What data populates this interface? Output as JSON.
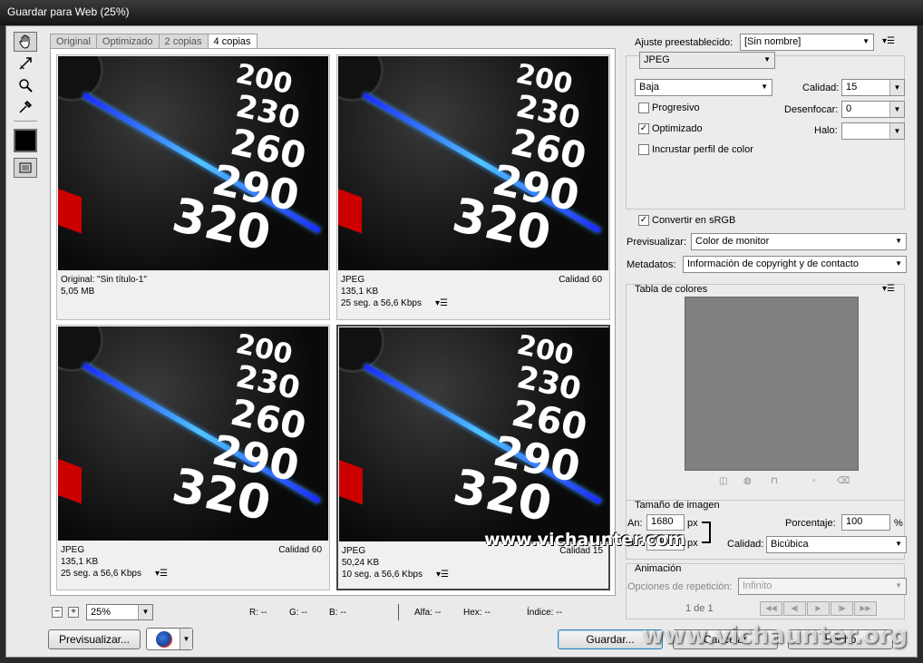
{
  "window": {
    "title": "Guardar para Web (25%)"
  },
  "tools": [
    "hand-tool",
    "slice-select-tool",
    "zoom-tool",
    "eyedropper-tool"
  ],
  "tabs": [
    "Original",
    "Optimizado",
    "2 copias",
    "4 copias"
  ],
  "active_tab": "4 copias",
  "dial_numbers": [
    "200",
    "230",
    "260",
    "290",
    "320"
  ],
  "panes": [
    {
      "line1": "Original: \"Sin título-1\"",
      "line2": "5,05 MB",
      "line3": "",
      "quality": ""
    },
    {
      "line1": "JPEG",
      "line2": "135,1 KB",
      "line3": "25 seg. a 56,6 Kbps",
      "quality": "Calidad 60"
    },
    {
      "line1": "JPEG",
      "line2": "135,1 KB",
      "line3": "25 seg. a 56,6 Kbps",
      "quality": "Calidad 60"
    },
    {
      "line1": "JPEG",
      "line2": "50,24 KB",
      "line3": "10 seg. a 56,6 Kbps",
      "quality": "Calidad 15"
    }
  ],
  "status": {
    "zoom_minus": "−",
    "zoom_plus": "+",
    "zoom": "25%",
    "r": "R: --",
    "g": "G: --",
    "b": "B: --",
    "alpha": "Alfa: --",
    "hex": "Hex: --",
    "index": "Índice: --"
  },
  "buttons": {
    "preview": "Previsualizar...",
    "save": "Guardar...",
    "cancel": "Cancelar",
    "done": "Hecho"
  },
  "settings": {
    "preset_label": "Ajuste preestablecido:",
    "preset_value": "[Sin nombre]",
    "format": "JPEG",
    "quality_level": "Baja",
    "quality_label": "Calidad:",
    "quality_value": "15",
    "blur_label": "Desenfocar:",
    "blur_value": "0",
    "matte_label": "Halo:",
    "matte_value": "",
    "progressive_label": "Progresivo",
    "optimized_label": "Optimizado",
    "embed_profile_label": "Incrustar perfil de color",
    "convert_srgb_label": "Convertir en sRGB",
    "preview_label": "Previsualizar:",
    "preview_value": "Color de monitor",
    "metadata_label": "Metadatos:",
    "metadata_value": "Información de copyright y de contacto"
  },
  "checks": {
    "progressive": false,
    "optimized": true,
    "embed_profile": false,
    "convert_srgb": true
  },
  "color_table": {
    "title": "Tabla de colores"
  },
  "image_size": {
    "title": "Tamaño de imagen",
    "width_label": "An:",
    "width_value": "1680",
    "height_label": "Al:",
    "height_value": "1050",
    "unit": "px",
    "percent_label": "Porcentaje:",
    "percent_value": "100",
    "percent_unit": "%",
    "quality_label": "Calidad:",
    "quality_value": "Bicúbica"
  },
  "animation": {
    "title": "Animación",
    "loop_label": "Opciones de repetición:",
    "loop_value": "Infinito",
    "frame": "1 de 1"
  },
  "watermarks": {
    "site1": "www.vichaunter.com",
    "site2": "www.vichaunter.org"
  }
}
